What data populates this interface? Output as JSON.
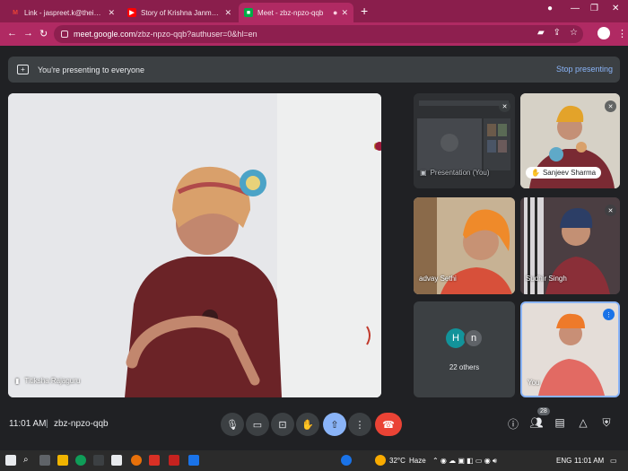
{
  "browser": {
    "tabs": [
      {
        "title": "Link - jaspreet.k@theindianschool",
        "favicon": "gmail-icon"
      },
      {
        "title": "Story of Krishna Janmashtami | K",
        "favicon": "youtube-icon"
      },
      {
        "title": "Meet - zbz-npzo-qqb",
        "favicon": "meet-icon",
        "active": true
      }
    ],
    "url_host": "meet.google.com",
    "url_path": "/zbz-npzo-qqb?authuser=0&hl=en"
  },
  "banner": {
    "text": "You're presenting to everyone",
    "stop_label": "Stop presenting"
  },
  "participants": {
    "main": "Titiksha Rajaguru",
    "presentation": "Presentation (You)",
    "sanjeev": "Sanjeev Sharma",
    "advay": "advay Sethi",
    "sudhir": "Sudhir Singh",
    "you": "You",
    "others_avatars": [
      "H",
      "n"
    ],
    "others_label": "22 others"
  },
  "meeting": {
    "time": "11:01 AM",
    "separator": "|",
    "code": "zbz-npzo-qqb",
    "participant_count": "28"
  },
  "taskbar": {
    "weather": "32°C",
    "weather_desc": "Haze",
    "lang": "ENG",
    "clock": "11:01 AM"
  },
  "colors": {
    "browser_frame": "#8a1e4c",
    "meet_bg": "#202124",
    "tile_bg": "#3c4043",
    "present_active": "#8ab4f8",
    "end_call": "#ea4335"
  }
}
